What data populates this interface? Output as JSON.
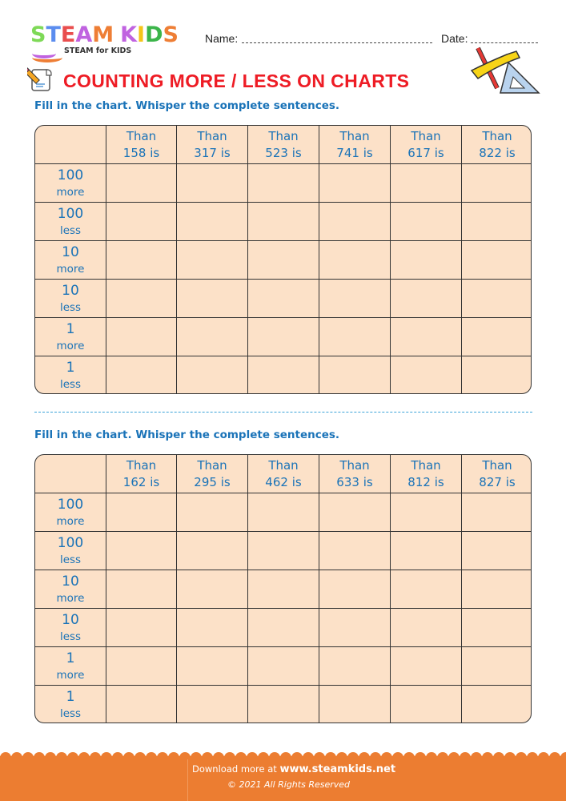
{
  "brand": {
    "logo_letters": [
      {
        "ch": "S",
        "color": "#7ed957"
      },
      {
        "ch": "T",
        "color": "#5b8def"
      },
      {
        "ch": "E",
        "color": "#e94e4e"
      },
      {
        "ch": "A",
        "color": "#c063e0"
      },
      {
        "ch": "M",
        "color": "#ee7e35"
      },
      {
        "ch": " ",
        "color": "#ffffff"
      },
      {
        "ch": "K",
        "color": "#c063e0"
      },
      {
        "ch": "I",
        "color": "#f5c518"
      },
      {
        "ch": "D",
        "color": "#3bb54a"
      },
      {
        "ch": "S",
        "color": "#ee7e35"
      }
    ],
    "tagline": "STEAM for KIDS"
  },
  "header": {
    "name_label": "Name:",
    "date_label": "Date:",
    "title": "COUNTING MORE / LESS ON CHARTS",
    "title_color": "#ee1c25"
  },
  "icons": {
    "worksheet": "pencil-paper-icon",
    "tools": "ruler-pencil-set-square-icon"
  },
  "sections": [
    {
      "instruction": "Fill in the chart. Whisper the complete sentences.",
      "columns": [
        {
          "line1": "Than",
          "line2": "158 is"
        },
        {
          "line1": "Than",
          "line2": "317 is"
        },
        {
          "line1": "Than",
          "line2": "523 is"
        },
        {
          "line1": "Than",
          "line2": "741 is"
        },
        {
          "line1": "Than",
          "line2": "617 is"
        },
        {
          "line1": "Than",
          "line2": "822 is"
        }
      ],
      "rows": [
        {
          "num": "100",
          "word": "more"
        },
        {
          "num": "100",
          "word": "less"
        },
        {
          "num": "10",
          "word": "more"
        },
        {
          "num": "10",
          "word": "less"
        },
        {
          "num": "1",
          "word": "more"
        },
        {
          "num": "1",
          "word": "less"
        }
      ]
    },
    {
      "instruction": "Fill in the chart. Whisper the complete sentences.",
      "columns": [
        {
          "line1": "Than",
          "line2": "162 is"
        },
        {
          "line1": "Than",
          "line2": "295 is"
        },
        {
          "line1": "Than",
          "line2": "462 is"
        },
        {
          "line1": "Than",
          "line2": "633 is"
        },
        {
          "line1": "Than",
          "line2": "812 is"
        },
        {
          "line1": "Than",
          "line2": "827 is"
        }
      ],
      "rows": [
        {
          "num": "100",
          "word": "more"
        },
        {
          "num": "100",
          "word": "less"
        },
        {
          "num": "10",
          "word": "more"
        },
        {
          "num": "10",
          "word": "less"
        },
        {
          "num": "1",
          "word": "more"
        },
        {
          "num": "1",
          "word": "less"
        }
      ]
    }
  ],
  "footer": {
    "download_prefix": "Download more at",
    "url": "www.steamkids.net",
    "copyright": "© 2021 All Rights Reserved",
    "color": "#ec7d31"
  }
}
